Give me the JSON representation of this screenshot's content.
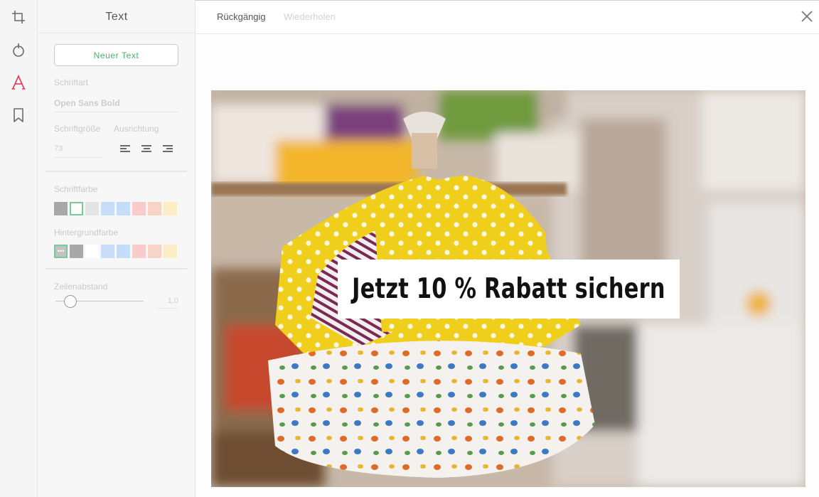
{
  "panel": {
    "title": "Text",
    "new_text_button": "Neuer Text",
    "font_label": "Schriftart",
    "font_value": "Open Sans Bold",
    "size_label": "Schriftgröße",
    "size_value": "73",
    "align_label": "Ausrichtung",
    "align_options": [
      "align-left",
      "align-center",
      "align-right"
    ],
    "font_color_label": "Schriftfarbe",
    "font_colors": [
      "#a8a8a8",
      "#ffffff",
      "#e4e4e4",
      "#c9ddfb",
      "#c6ddf8",
      "#f8cccb",
      "#f8d4c8",
      "#fcedc7"
    ],
    "background_color_label": "Hintergrundfarbe",
    "background_colors": [
      "#c2c2c2",
      "#a8a8a8",
      "#ffffff",
      "#c9ddfb",
      "#c6ddf8",
      "#f8cccb",
      "#f8d4c8",
      "#fcedc7"
    ],
    "line_height_label": "Zeilenabstand",
    "line_height_value": "1.0",
    "line_height_level": 0.17
  },
  "toolbar": {
    "undo_label": "Rückgängig",
    "redo_label": "Wiederholen"
  },
  "rail": {
    "icons": [
      "crop-icon",
      "filter-icon",
      "text-icon",
      "sticker-icon"
    ],
    "active": "text-icon",
    "accent_color": "#e53950"
  },
  "canvas": {
    "overlay_text": "Jetzt 10 % Rabatt sichern",
    "overlay_background": "#ffffff"
  }
}
